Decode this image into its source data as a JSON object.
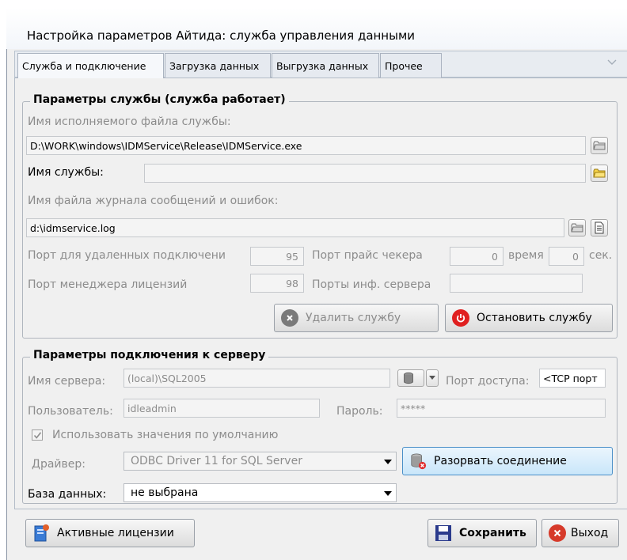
{
  "window": {
    "title": "Настройка параметров Айтида: служба управления данными"
  },
  "tabs": [
    {
      "label": "Служба и подключение"
    },
    {
      "label": "Загрузка данных"
    },
    {
      "label": "Выгрузка данных"
    },
    {
      "label": "Прочее"
    }
  ],
  "service_group": {
    "title": "Параметры службы (служба работает)",
    "exe_label": "Имя исполняемого файла службы:",
    "exe_value": "D:\\WORK\\windows\\IDMService\\Release\\IDMService.exe",
    "name_label": "Имя службы:",
    "name_value": "",
    "log_label": "Имя файла журнала сообщений и ошибок:",
    "log_value": "d:\\idmservice.log",
    "remote_port_label": "Порт для удаленных подключени",
    "remote_port_value": "95",
    "price_port_label": "Порт прайс чекера",
    "price_port_value": "0",
    "time_label": "время",
    "time_value": "0",
    "sec_label": "сек.",
    "license_port_label": "Порт менеджера лицензий",
    "license_port_value": "98",
    "info_ports_label": "Порты инф. сервера",
    "info_ports_value": "",
    "delete_button": "Удалить службу",
    "stop_button": "Остановить службу"
  },
  "connection_group": {
    "title": "Параметры подключения к серверу",
    "server_label": "Имя сервера:",
    "server_value": "(local)\\SQL2005",
    "access_port_label": "Порт доступа:",
    "access_port_value": "<TCP порт",
    "user_label": "Пользователь:",
    "user_value": "idleadmin",
    "password_label": "Пароль:",
    "password_value": "*****",
    "defaults_label": "Использовать значения по умолчанию",
    "defaults_checked": true,
    "driver_label": "Драйвер:",
    "driver_value": "ODBC Driver 11 for SQL Server",
    "disconnect_button": "Разорвать соединение",
    "database_label": "База данных:",
    "database_value": "не выбрана"
  },
  "footer": {
    "licenses_button": "Активные лицензии",
    "save_button": "Сохранить",
    "exit_button": "Выход"
  },
  "colors": {
    "stop_icon": "#e02020",
    "delete_icon": "#777777",
    "exit_icon": "#d63a2a",
    "save_icon": "#2a3a8c"
  }
}
